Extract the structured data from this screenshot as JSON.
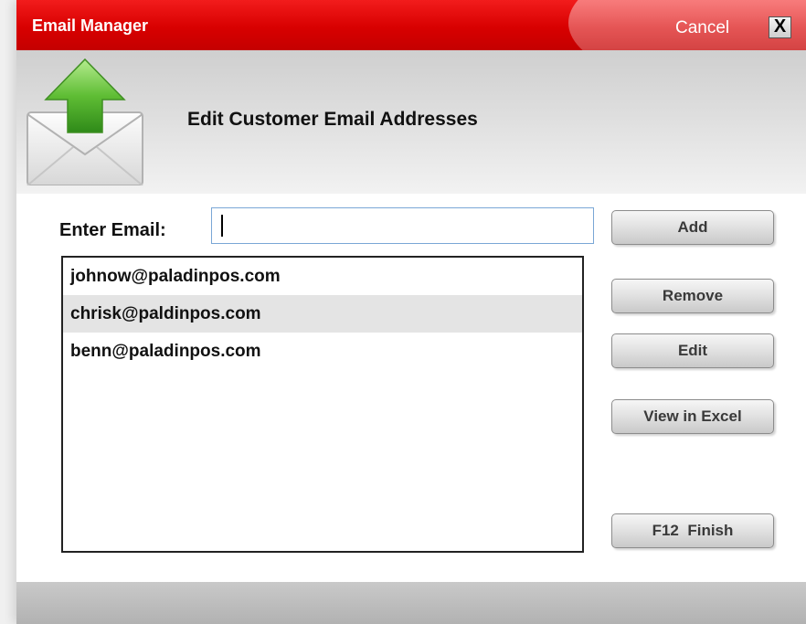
{
  "window": {
    "title": "Email Manager",
    "cancel_label": "Cancel",
    "close_label": "X"
  },
  "header": {
    "title": "Edit Customer Email Addresses",
    "icon": "email-upload-icon"
  },
  "form": {
    "email_label": "Enter Email:",
    "email_value": "",
    "email_placeholder": ""
  },
  "emails": [
    "johnow@paladinpos.com",
    "chrisk@paldinpos.com",
    "benn@paladinpos.com"
  ],
  "selected_email_index": 1,
  "buttons": {
    "add": "Add",
    "remove": "Remove",
    "edit": "Edit",
    "view_excel": "View in Excel",
    "finish": "F12  Finish"
  },
  "colors": {
    "titlebar": "#d80000",
    "selected_row": "#e4e4e4",
    "input_border": "#7aa7d6"
  }
}
